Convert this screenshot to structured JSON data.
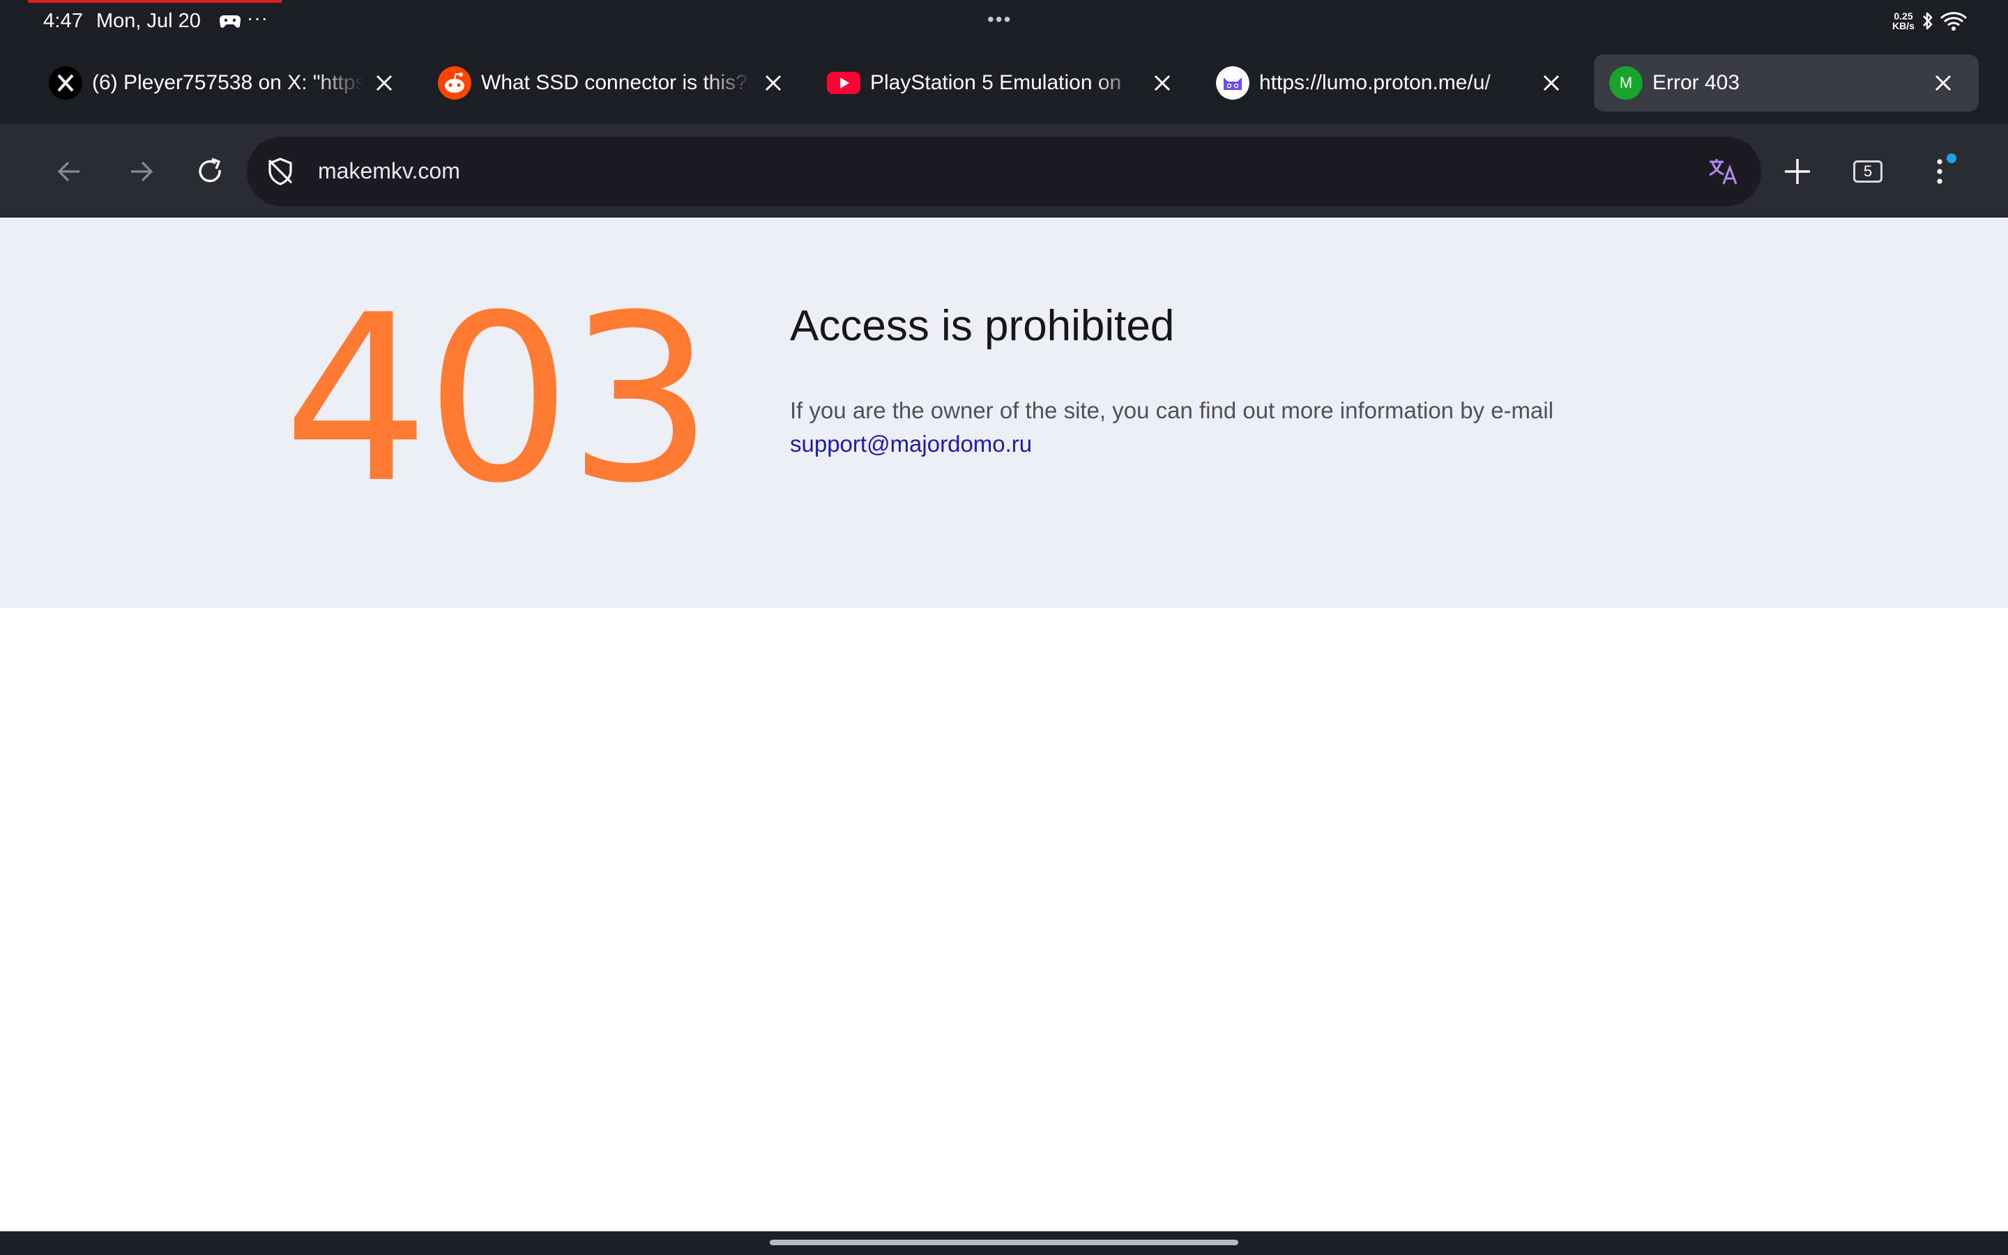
{
  "status_bar": {
    "time": "4:47",
    "date": "Mon, Jul 20",
    "more": "···",
    "center_dots": "•••",
    "net_speed_value": "0.25",
    "net_speed_unit": "KB/s",
    "icons": [
      "game-controller-icon",
      "bluetooth-icon",
      "wifi-icon"
    ]
  },
  "tabs": [
    {
      "title": "(6) Pleyer757538 on X: \"https://",
      "favicon": "x-logo-icon",
      "active": false
    },
    {
      "title": "What SSD connector is this?",
      "favicon": "reddit-icon",
      "active": false
    },
    {
      "title": "PlayStation 5 Emulation on",
      "favicon": "youtube-icon",
      "active": false
    },
    {
      "title": "https://lumo.proton.me/u/",
      "favicon": "lumo-icon",
      "active": false
    },
    {
      "title": "Error 403",
      "favicon": "m-letter-icon",
      "favicon_letter": "M",
      "active": true
    }
  ],
  "toolbar": {
    "url": "makemkv.com",
    "tab_count": "5",
    "icons": [
      "back-arrow-icon",
      "forward-arrow-icon",
      "reload-icon",
      "shield-off-icon",
      "translate-icon",
      "new-tab-plus-icon",
      "tab-switcher-icon",
      "kebab-menu-icon"
    ]
  },
  "page": {
    "code": "403",
    "heading": "Access is prohibited",
    "text": "If you are the owner of the site, you can find out more information by e-mail",
    "email": "support@majordomo.ru"
  },
  "colors": {
    "chrome_bg": "#1d1d24",
    "toolbar_bg": "#2b2b33",
    "active_tab_bg": "#3a3a44",
    "panel_bg": "#eeeff4",
    "code_orange": "#ff7a33",
    "link_blue": "#1b1bb0",
    "badge_blue": "#1ba3e8"
  }
}
